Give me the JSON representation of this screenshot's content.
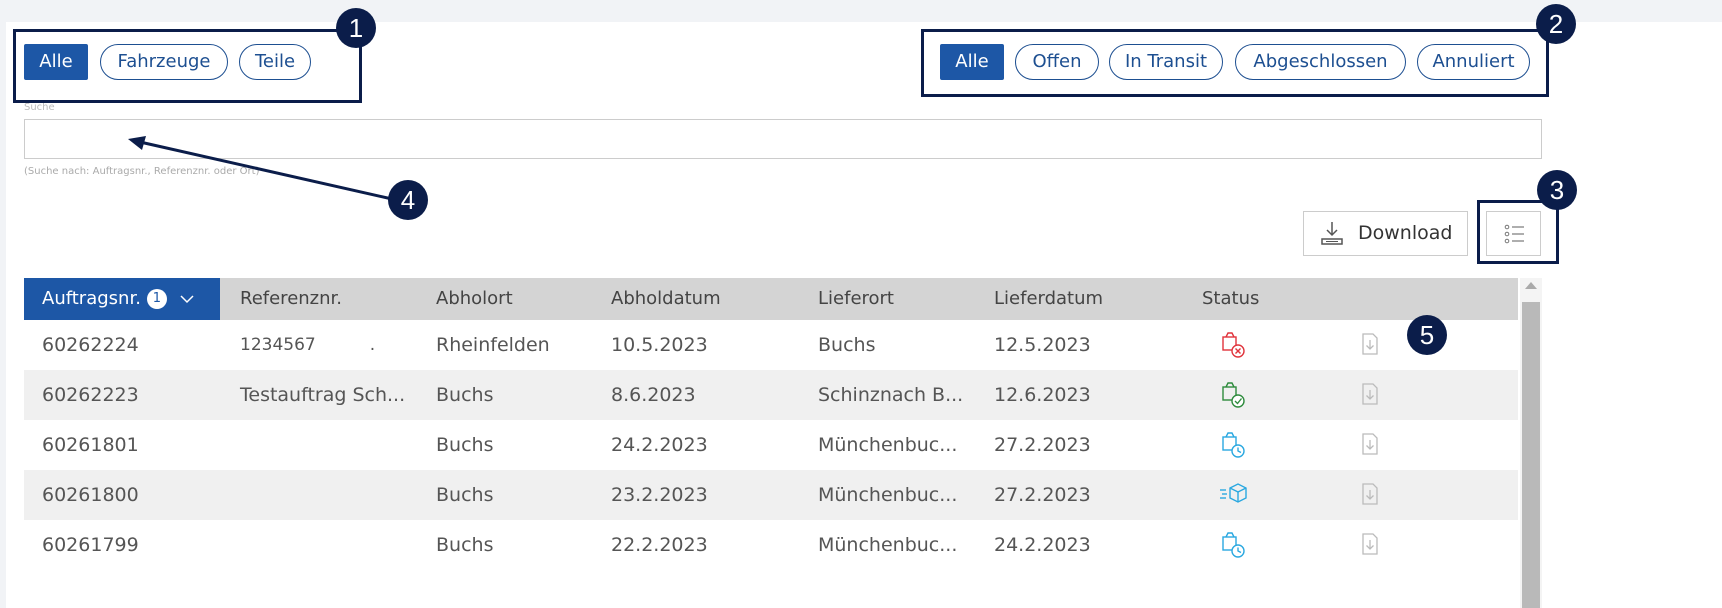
{
  "type_filters": [
    {
      "label": "Alle",
      "active": true
    },
    {
      "label": "Fahrzeuge",
      "active": false
    },
    {
      "label": "Teile",
      "active": false
    }
  ],
  "status_filters": [
    {
      "label": "Alle",
      "active": true
    },
    {
      "label": "Offen",
      "active": false
    },
    {
      "label": "In Transit",
      "active": false
    },
    {
      "label": "Abgeschlossen",
      "active": false
    },
    {
      "label": "Annuliert",
      "active": false
    }
  ],
  "search": {
    "label": "Suche",
    "value": "",
    "hint": "(Suche nach: Auftragsnr., Referenznr. oder Ort)"
  },
  "toolbar": {
    "download_label": "Download"
  },
  "callouts": [
    "1",
    "2",
    "3",
    "4",
    "5"
  ],
  "table": {
    "columns": [
      "Auftragsnr.",
      "Referenznr.",
      "Abholort",
      "Abholdatum",
      "Lieferort",
      "Lieferdatum",
      "Status"
    ],
    "sort_index": "1",
    "rows": [
      {
        "auftragsnr": "60262224",
        "referenznr": "1234567          .",
        "abholort": "Rheinfelden",
        "abholdatum": "10.5.2023",
        "lieferort": "Buchs",
        "lieferdatum": "12.5.2023",
        "status": "cancelled"
      },
      {
        "auftragsnr": "60262223",
        "referenznr": "Testauftrag Sch...",
        "abholort": "Buchs",
        "abholdatum": "8.6.2023",
        "lieferort": "Schinznach B...",
        "lieferdatum": "12.6.2023",
        "status": "completed"
      },
      {
        "auftragsnr": "60261801",
        "referenznr": "",
        "abholort": "Buchs",
        "abholdatum": "24.2.2023",
        "lieferort": "Münchenbuc...",
        "lieferdatum": "27.2.2023",
        "status": "open"
      },
      {
        "auftragsnr": "60261800",
        "referenznr": "",
        "abholort": "Buchs",
        "abholdatum": "23.2.2023",
        "lieferort": "Münchenbuc...",
        "lieferdatum": "27.2.2023",
        "status": "in-transit"
      },
      {
        "auftragsnr": "60261799",
        "referenznr": "",
        "abholort": "Buchs",
        "abholdatum": "22.2.2023",
        "lieferort": "Münchenbuc...",
        "lieferdatum": "24.2.2023",
        "status": "open"
      }
    ]
  },
  "colors": {
    "primary": "#1d57a6",
    "callout": "#0b1d4a",
    "status_cancelled": "#e0343c",
    "status_completed": "#2e8b3d",
    "status_open": "#2aa8e0"
  }
}
